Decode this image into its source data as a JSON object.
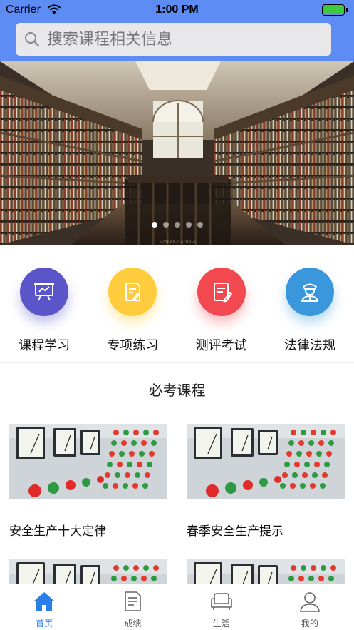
{
  "status_bar": {
    "carrier": "Carrier",
    "time": "1:00 PM"
  },
  "search": {
    "placeholder": "搜索课程相关信息"
  },
  "banner": {
    "image": "library-bookshelves-photo",
    "engraving_text": "AMERICA   AFRICA",
    "dot_count": 5,
    "active_dot": 0
  },
  "categories": [
    {
      "label": "课程学习",
      "icon": "presentation-board-icon",
      "color": "#5a55c8"
    },
    {
      "label": "专项练习",
      "icon": "edit-document-icon",
      "color": "#ffcc3d"
    },
    {
      "label": "测评考试",
      "icon": "exam-pencil-icon",
      "color": "#f2484f"
    },
    {
      "label": "法律法规",
      "icon": "police-officer-icon",
      "color": "#3a97dc"
    }
  ],
  "section": {
    "title": "必考课程"
  },
  "courses": [
    {
      "title": "安全生产十大定律",
      "image": "control-panel-photo"
    },
    {
      "title": "春季安全生产提示",
      "image": "control-panel-photo"
    },
    {
      "title": "",
      "image": "control-panel-photo"
    },
    {
      "title": "",
      "image": "control-panel-photo"
    }
  ],
  "tabbar": [
    {
      "label": "首页",
      "icon": "home-icon",
      "active": true
    },
    {
      "label": "成绩",
      "icon": "document-icon",
      "active": false
    },
    {
      "label": "生活",
      "icon": "sofa-icon",
      "active": false
    },
    {
      "label": "我的",
      "icon": "user-icon",
      "active": false
    }
  ],
  "colors": {
    "header": "#5c8cf4",
    "tab_active": "#2a7ee8"
  }
}
